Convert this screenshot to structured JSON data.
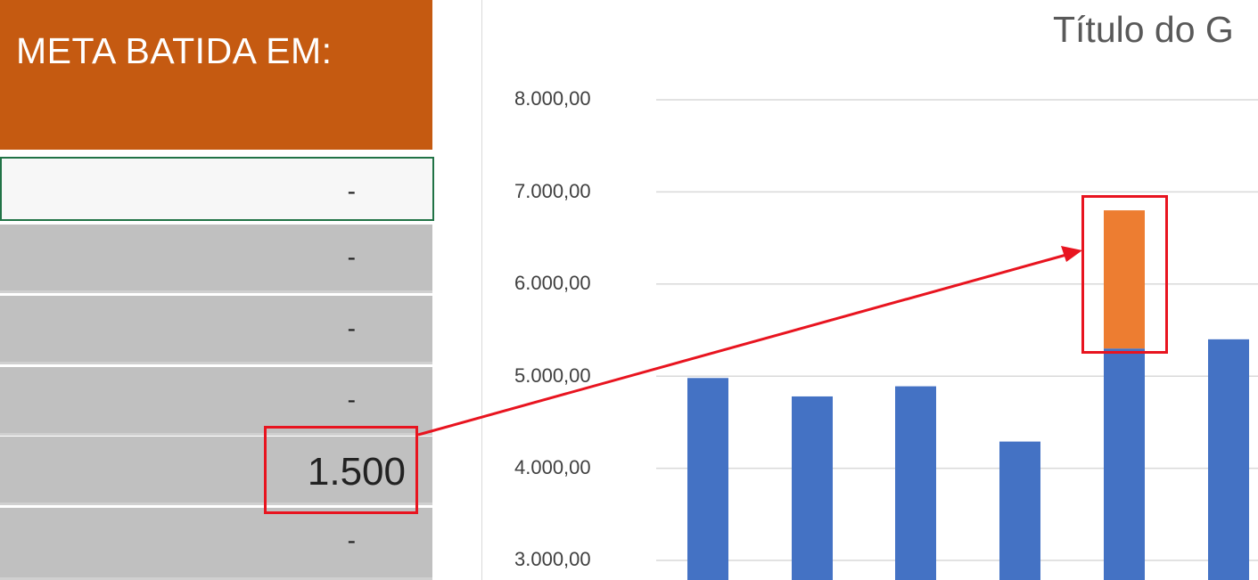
{
  "sheet": {
    "header": "META BATIDA EM:",
    "cells": [
      "-",
      "-",
      "-",
      "-",
      "1.500",
      "-"
    ]
  },
  "chart_data": {
    "type": "bar",
    "title": "Título do G",
    "y_ticks": [
      "8.000,00",
      "7.000,00",
      "6.000,00",
      "5.000,00",
      "4.000,00",
      "3.000,00"
    ],
    "ylim_visible": [
      2750,
      8000
    ],
    "series": [
      {
        "values": [
          4980,
          4780,
          4890,
          4290,
          5300,
          5400
        ],
        "color": "#4472c4"
      },
      {
        "values": [
          0,
          0,
          0,
          0,
          1500,
          0
        ],
        "color": "#ed7d31"
      }
    ],
    "gridlines": true
  },
  "annotation": {
    "color": "#e8141f",
    "from": "cell-1500",
    "to": "bar-5-stack"
  }
}
